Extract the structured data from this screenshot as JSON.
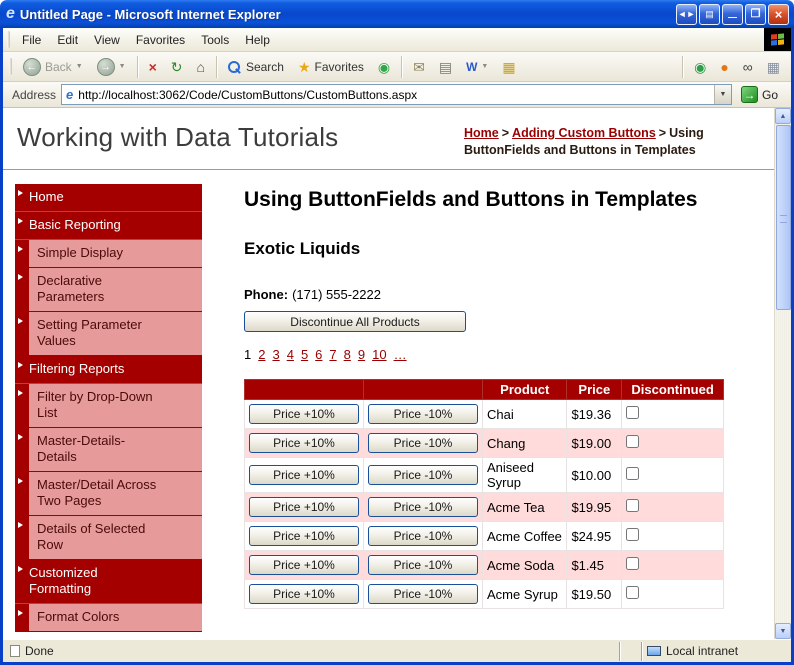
{
  "window": {
    "title": "Untitled Page - Microsoft Internet Explorer",
    "browser_icon": "e"
  },
  "titlebar": {
    "nav_pair_glyph": "◄►",
    "page_glyph": "▤",
    "min_glyph": "—",
    "max_glyph": "❐",
    "close_glyph": "×"
  },
  "menu": {
    "items": [
      "File",
      "Edit",
      "View",
      "Favorites",
      "Tools",
      "Help"
    ]
  },
  "toolbar": {
    "back": {
      "label": "Back",
      "glyph": "←"
    },
    "forward_glyph": "→",
    "dropdown_glyph": "▼",
    "stop_glyph": "×",
    "refresh_glyph": "↻",
    "home_glyph": "⌂",
    "search_label": "Search",
    "favorites_label": "Favorites",
    "favorites_glyph": "★",
    "media_glyph": "◉",
    "mail_glyph": "✉",
    "print_glyph": "▤",
    "edit_glyph": "W",
    "discuss_glyph": "▦",
    "ext_glyphs": [
      "◉",
      "●",
      "∞",
      "▦"
    ]
  },
  "address": {
    "label": "Address",
    "ie_glyph": "e",
    "url": "http://localhost:3062/Code/CustomButtons/CustomButtons.aspx",
    "dropdown_glyph": "▼",
    "go_glyph": "→",
    "go_label": "Go"
  },
  "header": {
    "site_title": "Working with Data Tutorials",
    "breadcrumb": {
      "home": "Home",
      "sep1": ">",
      "section": "Adding Custom Buttons",
      "sep2": ">",
      "current": "Using ButtonFields and Buttons in Templates"
    }
  },
  "sidebar": {
    "items": [
      {
        "label": "Home",
        "level": "top"
      },
      {
        "label": "Basic Reporting",
        "level": "top"
      },
      {
        "label": "Simple Display",
        "level": "sub"
      },
      {
        "label": "Declarative Parameters",
        "level": "sub"
      },
      {
        "label": "Setting Parameter Values",
        "level": "sub"
      },
      {
        "label": "Filtering Reports",
        "level": "top"
      },
      {
        "label": "Filter by Drop-Down List",
        "level": "sub"
      },
      {
        "label": "Master-Details-Details",
        "level": "sub"
      },
      {
        "label": "Master/Detail Across Two Pages",
        "level": "sub"
      },
      {
        "label": "Details of Selected Row",
        "level": "sub"
      },
      {
        "label": "Customized Formatting",
        "level": "top"
      },
      {
        "label": "Format Colors",
        "level": "sub"
      }
    ]
  },
  "main": {
    "heading": "Using ButtonFields and Buttons in Templates",
    "supplier": "Exotic Liquids",
    "phone_label": "Phone:",
    "phone": "(171) 555-2222",
    "discontinue_label": "Discontinue All Products",
    "pager": {
      "pages": [
        "1",
        "2",
        "3",
        "4",
        "5",
        "6",
        "7",
        "8",
        "9",
        "10",
        "…"
      ]
    },
    "table": {
      "headers": [
        "Product",
        "Price",
        "Discontinued"
      ],
      "plus_label": "Price +10%",
      "minus_label": "Price -10%",
      "rows": [
        {
          "product": "Chai",
          "price": "$19.36",
          "discontinued": false
        },
        {
          "product": "Chang",
          "price": "$19.00",
          "discontinued": false
        },
        {
          "product": "Aniseed Syrup",
          "price": "$10.00",
          "discontinued": false
        },
        {
          "product": "Acme Tea",
          "price": "$19.95",
          "discontinued": false
        },
        {
          "product": "Acme Coffee",
          "price": "$24.95",
          "discontinued": false
        },
        {
          "product": "Acme Soda",
          "price": "$1.45",
          "discontinued": false
        },
        {
          "product": "Acme Syrup",
          "price": "$19.50",
          "discontinued": false
        }
      ]
    }
  },
  "scrollbar": {
    "up_glyph": "▲",
    "down_glyph": "▼"
  },
  "statusbar": {
    "left": "Done",
    "right": "Local intranet"
  },
  "colors": {
    "titlebar_blue": "#0848CC",
    "maroon_dark": "#A40000",
    "link_maroon": "#990000",
    "sidebar_item_pink": "#E79A9A",
    "row_pink": "#FFDBDB",
    "chrome_tan": "#ECE9D8"
  }
}
